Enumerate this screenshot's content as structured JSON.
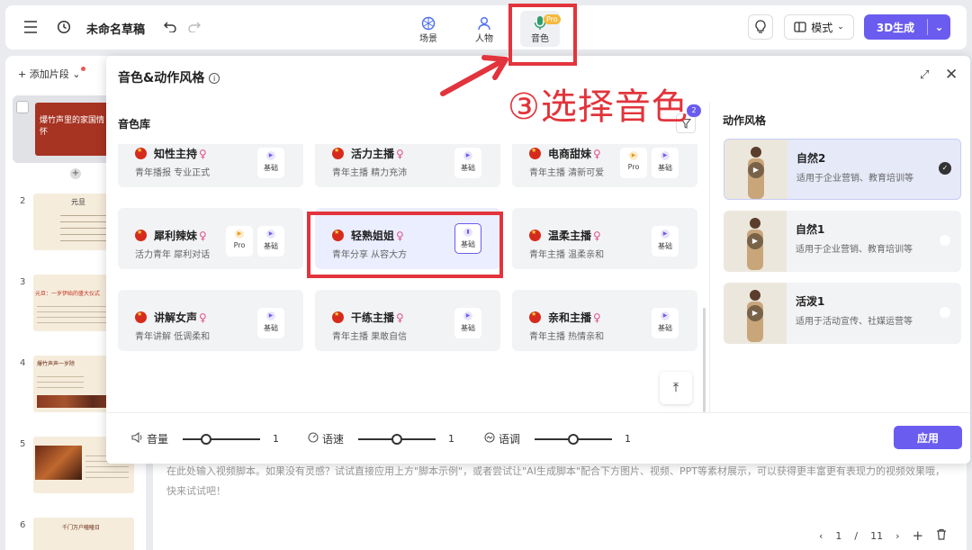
{
  "topbar": {
    "doc_title": "未命名草稿",
    "tabs": [
      {
        "label": "场景",
        "icon": "scene-icon"
      },
      {
        "label": "人物",
        "icon": "person-icon"
      },
      {
        "label": "音色",
        "icon": "microphone-icon",
        "badge": "Pro",
        "active": true
      }
    ],
    "mode_label": "模式",
    "generate_label": "3D生成"
  },
  "left_panel": {
    "add_clip_label": "添加片段",
    "slides": [
      {
        "num": "",
        "title": "爆竹声里的家国情怀"
      },
      {
        "num": "2",
        "title": "元旦"
      },
      {
        "num": "3",
        "title": "元旦：一岁伊始的盛大仪式"
      },
      {
        "num": "4",
        "title": "爆竹声声一岁除"
      },
      {
        "num": "5",
        "title": ""
      },
      {
        "num": "6",
        "title": "千门万户曈曈日"
      }
    ]
  },
  "editor": {
    "placeholder": "在此处输入视频脚本。如果没有灵感？试试直接应用上方\"脚本示例\"，或者尝试让\"AI生成脚本\"配合下方图片、视频、PPT等素材展示，可以获得更丰富更有表现力的视频效果哦，快来试试吧！",
    "page_current": "1",
    "page_sep": "/",
    "page_total": "11"
  },
  "modal": {
    "title": "音色&动作风格",
    "library_title": "音色库",
    "filter_badge": "2",
    "voices": [
      {
        "name": "知性主持",
        "desc": "青年播报 专业正式",
        "tags": [
          "基础"
        ]
      },
      {
        "name": "活力主播",
        "desc": "青年主播 精力充沛",
        "tags": [
          "基础"
        ]
      },
      {
        "name": "电商甜妹",
        "desc": "青年主播 清新可爱",
        "tags": [
          "Pro",
          "基础"
        ]
      },
      {
        "name": "犀利辣妹",
        "desc": "活力青年 犀利对话",
        "tags": [
          "Pro",
          "基础"
        ]
      },
      {
        "name": "轻熟姐姐",
        "desc": "青年分享 从容大方",
        "tags": [
          "基础"
        ],
        "selected": true
      },
      {
        "name": "温柔主播",
        "desc": "青年主播 温柔亲和",
        "tags": [
          "基础"
        ]
      },
      {
        "name": "讲解女声",
        "desc": "青年讲解 低调柔和",
        "tags": [
          "基础"
        ]
      },
      {
        "name": "干练主播",
        "desc": "青年主播 果敢自信",
        "tags": [
          "基础"
        ]
      },
      {
        "name": "亲和主播",
        "desc": "青年主播 热情亲和",
        "tags": [
          "基础"
        ]
      }
    ],
    "motion_title": "动作风格",
    "motions": [
      {
        "name": "自然2",
        "desc": "适用于企业营销、教育培训等",
        "selected": true
      },
      {
        "name": "自然1",
        "desc": "适用于企业营销、教育培训等"
      },
      {
        "name": "活泼1",
        "desc": "适用于活动宣传、社媒运营等"
      }
    ],
    "sliders": [
      {
        "label": "音量",
        "value": "1",
        "level": 0.3
      },
      {
        "label": "语速",
        "value": "1",
        "level": 0.5
      },
      {
        "label": "语调",
        "value": "1",
        "level": 0.5
      }
    ],
    "apply_label": "应用"
  },
  "annotation": {
    "text": "③选择音色"
  },
  "colors": {
    "accent": "#6b5cf0",
    "annotation": "#e2343c"
  }
}
